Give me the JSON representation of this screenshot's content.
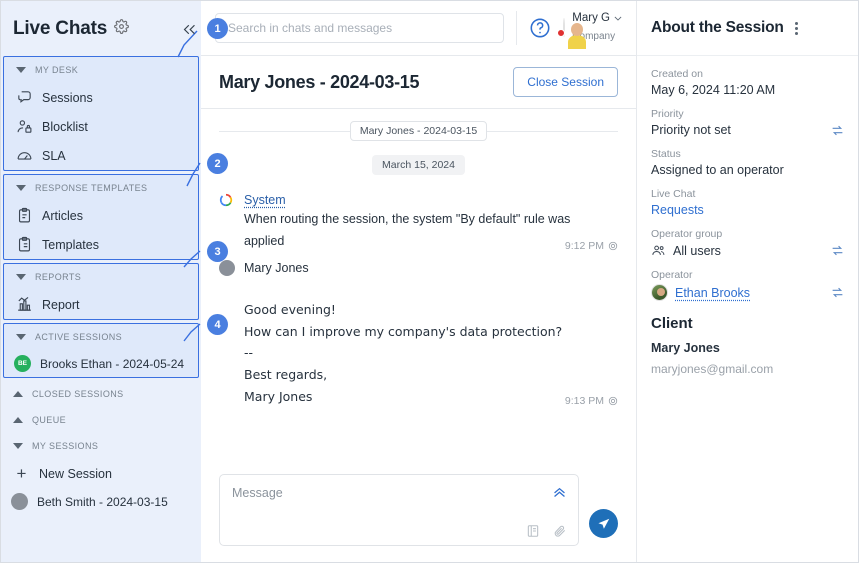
{
  "sidebar": {
    "title": "Live Chats",
    "gear_icon": "gear-icon",
    "collapse_icon": "collapse-left-icon",
    "groups": [
      {
        "section": "MY DESK",
        "caret": "down",
        "boxed": true,
        "items": [
          {
            "label": "Sessions",
            "icon": "chat-bubbles-icon"
          },
          {
            "label": "Blocklist",
            "icon": "person-block-icon"
          },
          {
            "label": "SLA",
            "icon": "gauge-icon"
          }
        ]
      },
      {
        "section": "RESPONSE TEMPLATES",
        "caret": "down",
        "boxed": true,
        "items": [
          {
            "label": "Articles",
            "icon": "clipboard-icon"
          },
          {
            "label": "Templates",
            "icon": "clipboard-list-icon"
          }
        ]
      },
      {
        "section": "REPORTS",
        "caret": "down",
        "boxed": true,
        "items": [
          {
            "label": "Report",
            "icon": "bar-chart-icon"
          }
        ]
      },
      {
        "section": "ACTIVE SESSIONS",
        "caret": "down",
        "boxed": true,
        "sessions": [
          {
            "label": "Brooks Ethan - 2024-05-24",
            "initials": "BE",
            "avatar": "green"
          }
        ]
      },
      {
        "section": "CLOSED SESSIONS",
        "caret": "up",
        "boxed": false,
        "items": []
      },
      {
        "section": "QUEUE",
        "caret": "up",
        "boxed": false,
        "items": []
      },
      {
        "section": "MY SESSIONS",
        "caret": "down",
        "boxed": false,
        "new_session_label": "New Session",
        "new_session_icon": "plus-icon",
        "sessions": [
          {
            "label": "Beth Smith - 2024-03-15",
            "initials": "",
            "avatar": "gray"
          }
        ]
      }
    ]
  },
  "topbar": {
    "search_placeholder": "Search in chats and messages",
    "search_value": "",
    "help_icon": "help-circle-icon",
    "user_name": "Mary G",
    "user_company": "Company",
    "chevron_icon": "chevron-down-icon",
    "avatar_icon": "user-avatar"
  },
  "chat": {
    "title": "Mary Jones - 2024-03-15",
    "close_button": "Close Session",
    "session_chip": "Mary Jones - 2024-03-15",
    "date_chip": "March 15, 2024",
    "messages": [
      {
        "author": "System",
        "author_style": "link",
        "icon": "system-loader-icon",
        "lines": [
          "When routing the session, the system \"By default\" rule was",
          "applied"
        ],
        "time": "9:12 PM",
        "status_icon": "read-receipt-icon"
      },
      {
        "author": "Mary Jones",
        "author_style": "plain",
        "icon": "avatar-gray",
        "lines": [
          "",
          "Good evening!",
          "How can I improve my company's data protection?",
          "--",
          "Best regards,",
          "Mary Jones"
        ],
        "time": "9:13 PM",
        "status_icon": "read-receipt-icon"
      }
    ],
    "composer_placeholder": "Message",
    "composer_value": "",
    "expand_icon": "chevron-double-up-icon",
    "template_icon": "template-icon",
    "attach_icon": "paperclip-icon",
    "send_icon": "send-icon"
  },
  "about": {
    "title": "About the Session",
    "menu_icon": "kebab-menu-icon",
    "fields": [
      {
        "label": "Created on",
        "value": "May 6, 2024 11:20 AM",
        "swap": false
      },
      {
        "label": "Priority",
        "value": "Priority not set",
        "swap": true
      },
      {
        "label": "Status",
        "value": "Assigned to an operator",
        "swap": false
      },
      {
        "label": "Live Chat",
        "value": "Requests",
        "swap": false,
        "link": true
      },
      {
        "label": "Operator group",
        "value": "All users",
        "swap": true,
        "icon": "group-icon"
      },
      {
        "label": "Operator",
        "value": "Ethan Brooks",
        "swap": true,
        "icon": "operator-avatar",
        "link": true,
        "underline": true
      }
    ],
    "client_heading": "Client",
    "client_name": "Mary Jones",
    "client_email": "maryjones@gmail.com"
  },
  "callouts": [
    {
      "number": "1"
    },
    {
      "number": "2"
    },
    {
      "number": "3"
    },
    {
      "number": "4"
    }
  ],
  "colors": {
    "accent": "#4a7fe0",
    "link": "#2f6fd0",
    "sidebar_bg": "#eaf0fb",
    "highlight_border": "#3a70e0",
    "send_button": "#1f6fb8"
  }
}
